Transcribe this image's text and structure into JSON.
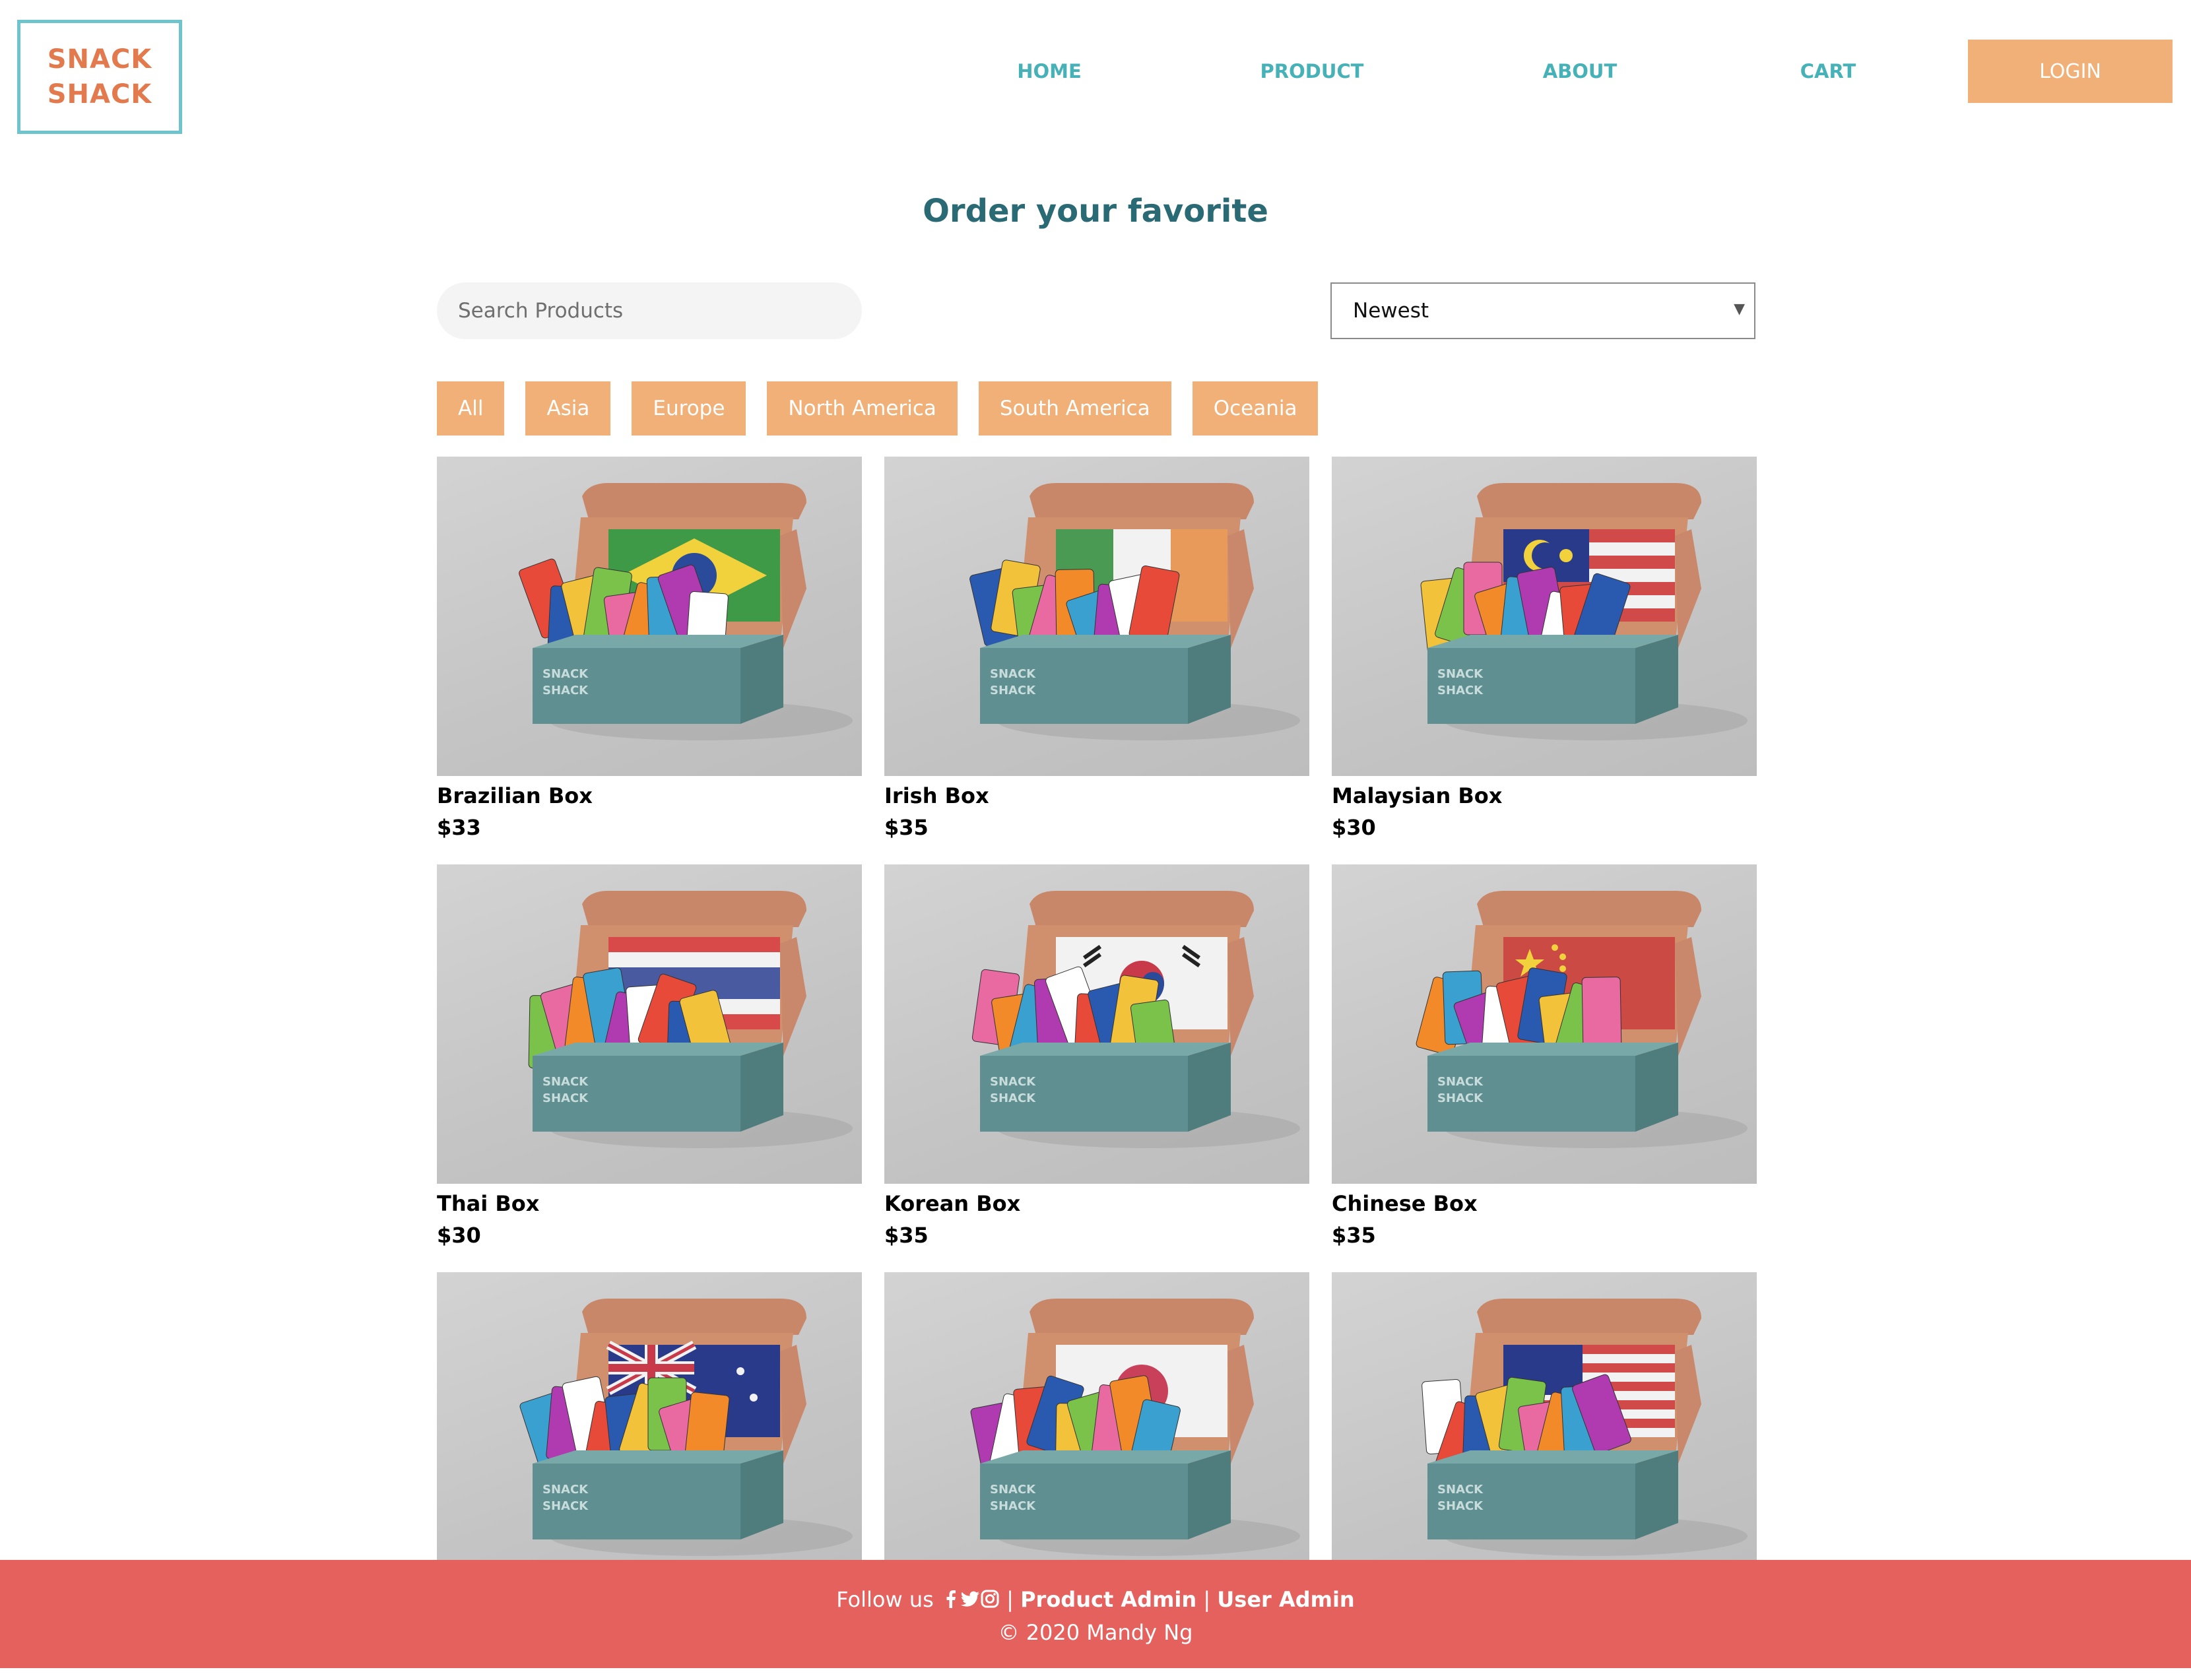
{
  "brand": {
    "line1": "SNACK",
    "line2": "SHACK"
  },
  "nav": {
    "home": "HOME",
    "product": "PRODUCT",
    "about": "ABOUT",
    "cart": "CART",
    "login": "LOGIN"
  },
  "page_title": "Order your favorite",
  "search": {
    "placeholder": "Search Products",
    "value": ""
  },
  "sort": {
    "selected": "Newest"
  },
  "filters": [
    "All",
    "Asia",
    "Europe",
    "North America",
    "South America",
    "Oceania"
  ],
  "products": [
    {
      "name": "Brazilian Box",
      "price": "$33",
      "flag": "brazil"
    },
    {
      "name": "Irish Box",
      "price": "$35",
      "flag": "ireland"
    },
    {
      "name": "Malaysian Box",
      "price": "$30",
      "flag": "malaysia"
    },
    {
      "name": "Thai Box",
      "price": "$30",
      "flag": "thailand"
    },
    {
      "name": "Korean Box",
      "price": "$35",
      "flag": "korea"
    },
    {
      "name": "Chinese Box",
      "price": "$35",
      "flag": "china"
    },
    {
      "name": "",
      "price": "",
      "flag": "australia"
    },
    {
      "name": "",
      "price": "",
      "flag": "japan"
    },
    {
      "name": "",
      "price": "",
      "flag": "usa"
    }
  ],
  "footer": {
    "follow": "Follow us",
    "separator": "|",
    "product_admin": "Product Admin",
    "user_admin": "User Admin",
    "copyright": "© 2020 Mandy Ng"
  },
  "colors": {
    "accent_orange": "#f0b077",
    "nav_teal": "#46b2b8",
    "title_teal": "#2a6a74",
    "footer_red": "#e5615e",
    "box_teal": "#5f8f90"
  }
}
